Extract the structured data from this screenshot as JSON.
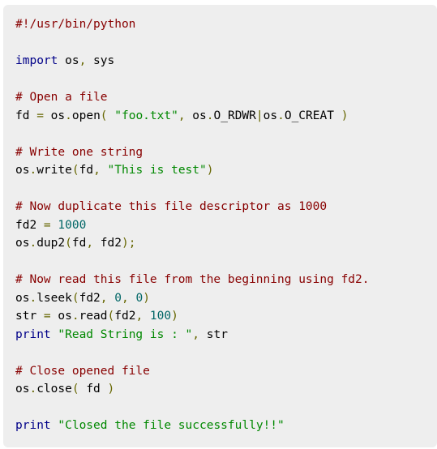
{
  "code": {
    "lines": [
      [
        {
          "t": "com",
          "v": "#!/usr/bin/python"
        }
      ],
      [],
      [
        {
          "t": "kwd",
          "v": "import"
        },
        {
          "t": "pln",
          "v": " os"
        },
        {
          "t": "pun",
          "v": ","
        },
        {
          "t": "pln",
          "v": " sys"
        }
      ],
      [],
      [
        {
          "t": "com",
          "v": "# Open a file"
        }
      ],
      [
        {
          "t": "pln",
          "v": "fd "
        },
        {
          "t": "pun",
          "v": "="
        },
        {
          "t": "pln",
          "v": " os"
        },
        {
          "t": "pun",
          "v": "."
        },
        {
          "t": "pln",
          "v": "open"
        },
        {
          "t": "pun",
          "v": "("
        },
        {
          "t": "pln",
          "v": " "
        },
        {
          "t": "str",
          "v": "\"foo.txt\""
        },
        {
          "t": "pun",
          "v": ","
        },
        {
          "t": "pln",
          "v": " os"
        },
        {
          "t": "pun",
          "v": "."
        },
        {
          "t": "pln",
          "v": "O_RDWR"
        },
        {
          "t": "pun",
          "v": "|"
        },
        {
          "t": "pln",
          "v": "os"
        },
        {
          "t": "pun",
          "v": "."
        },
        {
          "t": "pln",
          "v": "O_CREAT "
        },
        {
          "t": "pun",
          "v": ")"
        }
      ],
      [],
      [
        {
          "t": "com",
          "v": "# Write one string"
        }
      ],
      [
        {
          "t": "pln",
          "v": "os"
        },
        {
          "t": "pun",
          "v": "."
        },
        {
          "t": "pln",
          "v": "write"
        },
        {
          "t": "pun",
          "v": "("
        },
        {
          "t": "pln",
          "v": "fd"
        },
        {
          "t": "pun",
          "v": ","
        },
        {
          "t": "pln",
          "v": " "
        },
        {
          "t": "str",
          "v": "\"This is test\""
        },
        {
          "t": "pun",
          "v": ")"
        }
      ],
      [],
      [
        {
          "t": "com",
          "v": "# Now duplicate this file descriptor as 1000"
        }
      ],
      [
        {
          "t": "pln",
          "v": "fd2 "
        },
        {
          "t": "pun",
          "v": "="
        },
        {
          "t": "pln",
          "v": " "
        },
        {
          "t": "lit",
          "v": "1000"
        }
      ],
      [
        {
          "t": "pln",
          "v": "os"
        },
        {
          "t": "pun",
          "v": "."
        },
        {
          "t": "pln",
          "v": "dup2"
        },
        {
          "t": "pun",
          "v": "("
        },
        {
          "t": "pln",
          "v": "fd"
        },
        {
          "t": "pun",
          "v": ","
        },
        {
          "t": "pln",
          "v": " fd2"
        },
        {
          "t": "pun",
          "v": ");"
        }
      ],
      [],
      [
        {
          "t": "com",
          "v": "# Now read this file from the beginning using fd2."
        }
      ],
      [
        {
          "t": "pln",
          "v": "os"
        },
        {
          "t": "pun",
          "v": "."
        },
        {
          "t": "pln",
          "v": "lseek"
        },
        {
          "t": "pun",
          "v": "("
        },
        {
          "t": "pln",
          "v": "fd2"
        },
        {
          "t": "pun",
          "v": ","
        },
        {
          "t": "pln",
          "v": " "
        },
        {
          "t": "lit",
          "v": "0"
        },
        {
          "t": "pun",
          "v": ","
        },
        {
          "t": "pln",
          "v": " "
        },
        {
          "t": "lit",
          "v": "0"
        },
        {
          "t": "pun",
          "v": ")"
        }
      ],
      [
        {
          "t": "pln",
          "v": "str "
        },
        {
          "t": "pun",
          "v": "="
        },
        {
          "t": "pln",
          "v": " os"
        },
        {
          "t": "pun",
          "v": "."
        },
        {
          "t": "pln",
          "v": "read"
        },
        {
          "t": "pun",
          "v": "("
        },
        {
          "t": "pln",
          "v": "fd2"
        },
        {
          "t": "pun",
          "v": ","
        },
        {
          "t": "pln",
          "v": " "
        },
        {
          "t": "lit",
          "v": "100"
        },
        {
          "t": "pun",
          "v": ")"
        }
      ],
      [
        {
          "t": "kwd",
          "v": "print"
        },
        {
          "t": "pln",
          "v": " "
        },
        {
          "t": "str",
          "v": "\"Read String is : \""
        },
        {
          "t": "pun",
          "v": ","
        },
        {
          "t": "pln",
          "v": " str"
        }
      ],
      [],
      [
        {
          "t": "com",
          "v": "# Close opened file"
        }
      ],
      [
        {
          "t": "pln",
          "v": "os"
        },
        {
          "t": "pun",
          "v": "."
        },
        {
          "t": "pln",
          "v": "close"
        },
        {
          "t": "pun",
          "v": "("
        },
        {
          "t": "pln",
          "v": " fd "
        },
        {
          "t": "pun",
          "v": ")"
        }
      ],
      [],
      [
        {
          "t": "kwd",
          "v": "print"
        },
        {
          "t": "pln",
          "v": " "
        },
        {
          "t": "str",
          "v": "\"Closed the file successfully!!\""
        }
      ]
    ]
  },
  "colors": {
    "background": "#eeeeee",
    "comment": "#880000",
    "keyword": "#000088",
    "string": "#008800",
    "number": "#006666",
    "punctuation": "#666600",
    "plain": "#000000"
  }
}
